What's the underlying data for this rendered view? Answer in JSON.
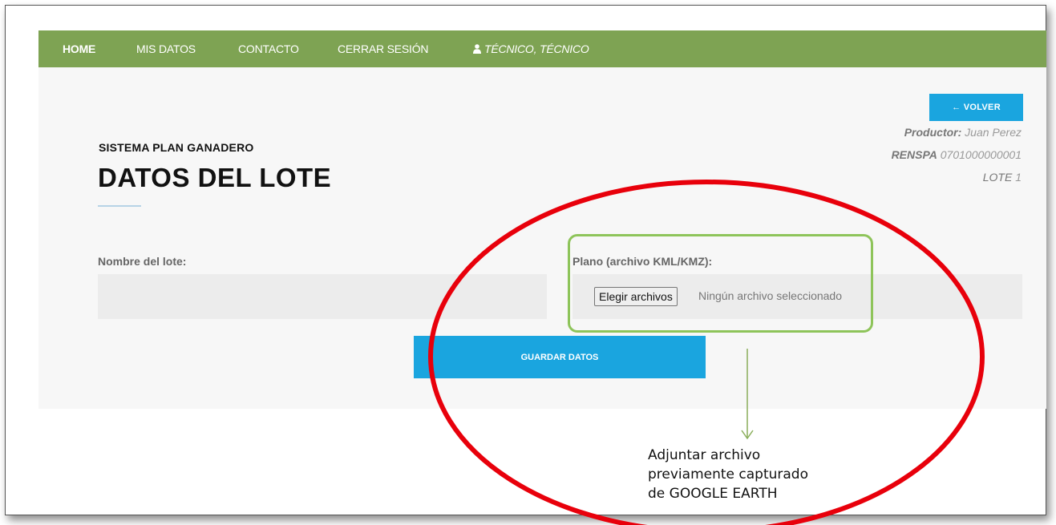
{
  "nav": {
    "home": "HOME",
    "my_data": "MIS DATOS",
    "contact": "CONTACTO",
    "logout": "CERRAR SESIÓN",
    "user": "TÉCNICO, TÉCNICO",
    "user_icon": "user-icon"
  },
  "header": {
    "subtitle": "SISTEMA PLAN GANADERO",
    "title": "DATOS DEL LOTE",
    "back_button": "← VOLVER",
    "producer_label": "Productor:",
    "producer_name": "Juan Perez",
    "renspa_label": "RENSPA",
    "renspa_value": "0701000000001",
    "lot_label": "LOTE",
    "lot_value": "1"
  },
  "form": {
    "lot_name_label": "Nombre del lote:",
    "lot_name_value": "",
    "plan_label": "Plano (archivo KML/KMZ):",
    "choose_files_button": "Elegir archivos",
    "file_status": "Ningún archivo seleccionado",
    "save_button": "GUARDAR DATOS"
  },
  "annotation": {
    "lines": [
      "Adjuntar archivo",
      "previamente capturado",
      "de GOOGLE EARTH"
    ],
    "ellipse_color": "#e8000b",
    "highlight_color": "#8ec45a",
    "arrow_color": "#8aae5a"
  },
  "colors": {
    "navbar": "#7ea353",
    "accent_button": "#1aa5df",
    "panel": "#f7f7f7"
  }
}
